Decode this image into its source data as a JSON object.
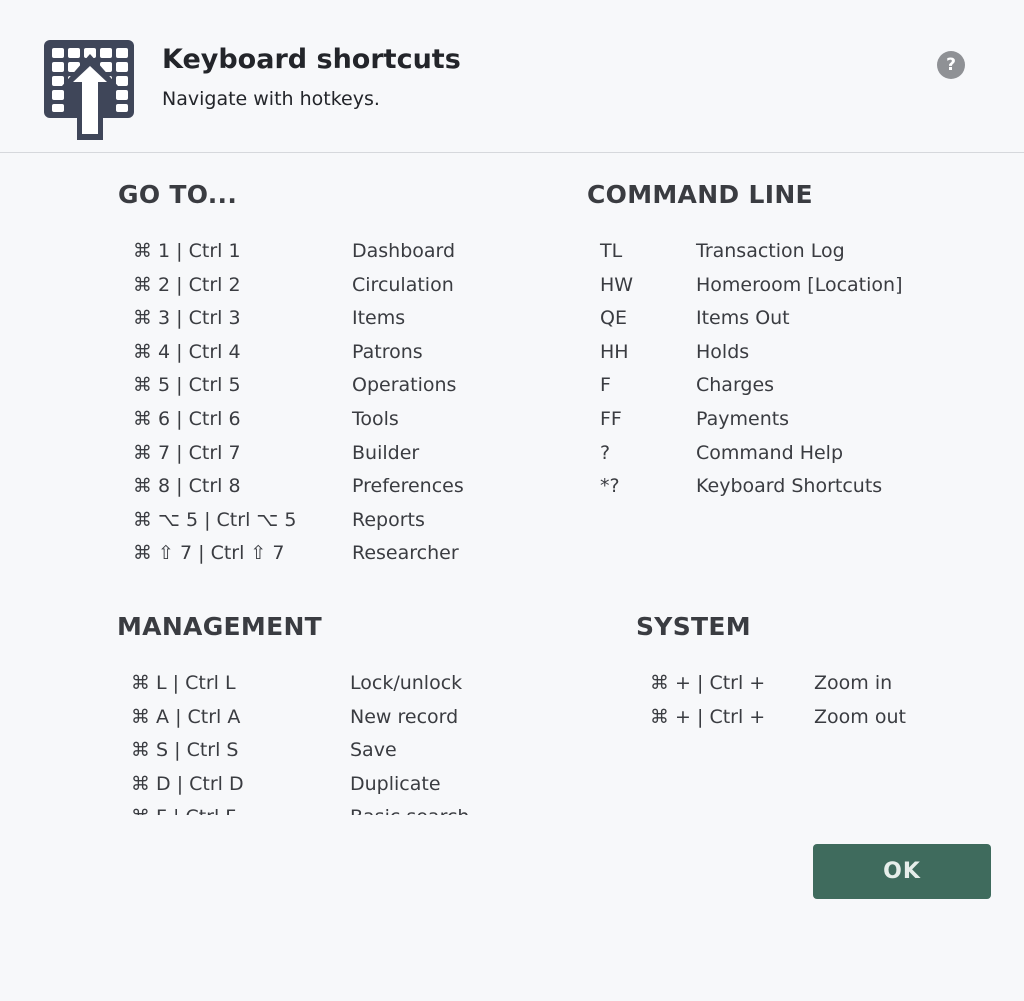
{
  "header": {
    "title": "Keyboard shortcuts",
    "subtitle": "Navigate with hotkeys.",
    "logo_icon": "keyboard-arrow-icon",
    "help_label": "?"
  },
  "colors": {
    "accent": "#3f6b5d",
    "logo": "#3f4659",
    "help": "#8f9195"
  },
  "sections": [
    {
      "id": "goto",
      "title": "GO TO...",
      "items": [
        {
          "key": "⌘ 1 | Ctrl 1",
          "label": "Dashboard"
        },
        {
          "key": "⌘ 2 | Ctrl 2",
          "label": "Circulation"
        },
        {
          "key": "⌘ 3 | Ctrl 3",
          "label": "Items"
        },
        {
          "key": "⌘ 4 | Ctrl 4",
          "label": "Patrons"
        },
        {
          "key": "⌘ 5 | Ctrl 5",
          "label": "Operations"
        },
        {
          "key": "⌘ 6 | Ctrl 6",
          "label": "Tools"
        },
        {
          "key": "⌘ 7 | Ctrl 7",
          "label": "Builder"
        },
        {
          "key": "⌘ 8 | Ctrl 8",
          "label": "Preferences"
        },
        {
          "key": "⌘ ⌥ 5 | Ctrl ⌥ 5",
          "label": "Reports"
        },
        {
          "key": "⌘ ⇧ 7 | Ctrl ⇧ 7",
          "label": "Researcher"
        }
      ]
    },
    {
      "id": "command",
      "title": "COMMAND LINE",
      "items": [
        {
          "key": "TL",
          "label": "Transaction Log"
        },
        {
          "key": "HW",
          "label": "Homeroom [Location]"
        },
        {
          "key": "QE",
          "label": "Items Out"
        },
        {
          "key": "HH",
          "label": "Holds"
        },
        {
          "key": "F",
          "label": "Charges"
        },
        {
          "key": "FF",
          "label": "Payments"
        },
        {
          "key": "?",
          "label": "Command Help"
        },
        {
          "key": "*?",
          "label": "Keyboard Shortcuts"
        }
      ]
    },
    {
      "id": "management",
      "title": "MANAGEMENT",
      "items": [
        {
          "key": "⌘ L | Ctrl L",
          "label": "Lock/unlock"
        },
        {
          "key": "⌘ A | Ctrl A",
          "label": "New record"
        },
        {
          "key": "⌘ S | Ctrl S",
          "label": "Save"
        },
        {
          "key": "⌘ D | Ctrl D",
          "label": "Duplicate"
        },
        {
          "key": "⌘ F | Ctrl F",
          "label": "Basic search"
        }
      ]
    },
    {
      "id": "system",
      "title": "SYSTEM",
      "items": [
        {
          "key": "⌘ + | Ctrl +",
          "label": "Zoom in"
        },
        {
          "key": "⌘ + | Ctrl +",
          "label": "Zoom out"
        }
      ]
    }
  ],
  "footer": {
    "ok_label": "OK"
  }
}
